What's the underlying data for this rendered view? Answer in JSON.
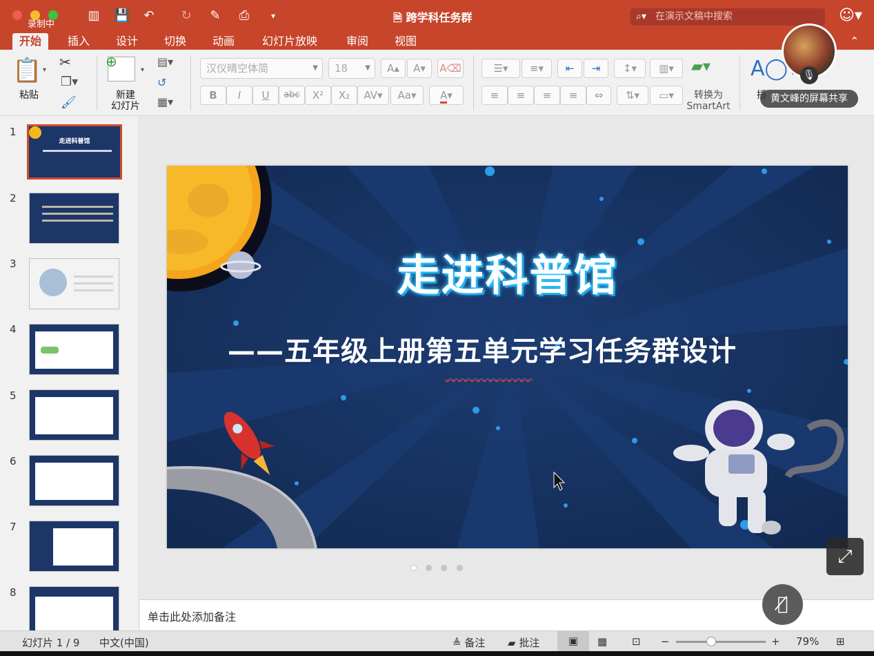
{
  "titlebar": {
    "recording_label": "录制中",
    "doc_title": "跨学科任务群",
    "search_placeholder": "在演示文稿中搜索"
  },
  "tabs": [
    "开始",
    "插入",
    "设计",
    "切换",
    "动画",
    "幻灯片放映",
    "审阅",
    "视图"
  ],
  "active_tab": "开始",
  "ribbon": {
    "paste_label": "粘贴",
    "new_slide_label_1": "新建",
    "new_slide_label_2": "幻灯片",
    "font_name": "汉仪晴空体简",
    "font_size": "18",
    "bold": "B",
    "italic": "I",
    "underline": "U",
    "strike": "abc",
    "superscript": "X²",
    "subscript": "X₂",
    "smartart_label_1": "转换为",
    "smartart_label_2": "SmartArt",
    "insert_label": "插"
  },
  "overlay": {
    "share_label": "黄文峰的屏幕共享"
  },
  "thumbnails": [
    {
      "num": "1",
      "title": "走进科普馆"
    },
    {
      "num": "2"
    },
    {
      "num": "3"
    },
    {
      "num": "4"
    },
    {
      "num": "5"
    },
    {
      "num": "6"
    },
    {
      "num": "7"
    },
    {
      "num": "8"
    }
  ],
  "slide": {
    "title": "走进科普馆",
    "subtitle": "——五年级上册第五单元学习任务群设计"
  },
  "notes_placeholder": "单击此处添加备注",
  "status": {
    "slide_counter": "幻灯片 1 / 9",
    "language": "中文(中国)",
    "notes_btn": "备注",
    "comments_btn": "批注",
    "zoom": "79%"
  },
  "colors": {
    "accent": "#c6452b",
    "slide_bg": "#16305d"
  }
}
